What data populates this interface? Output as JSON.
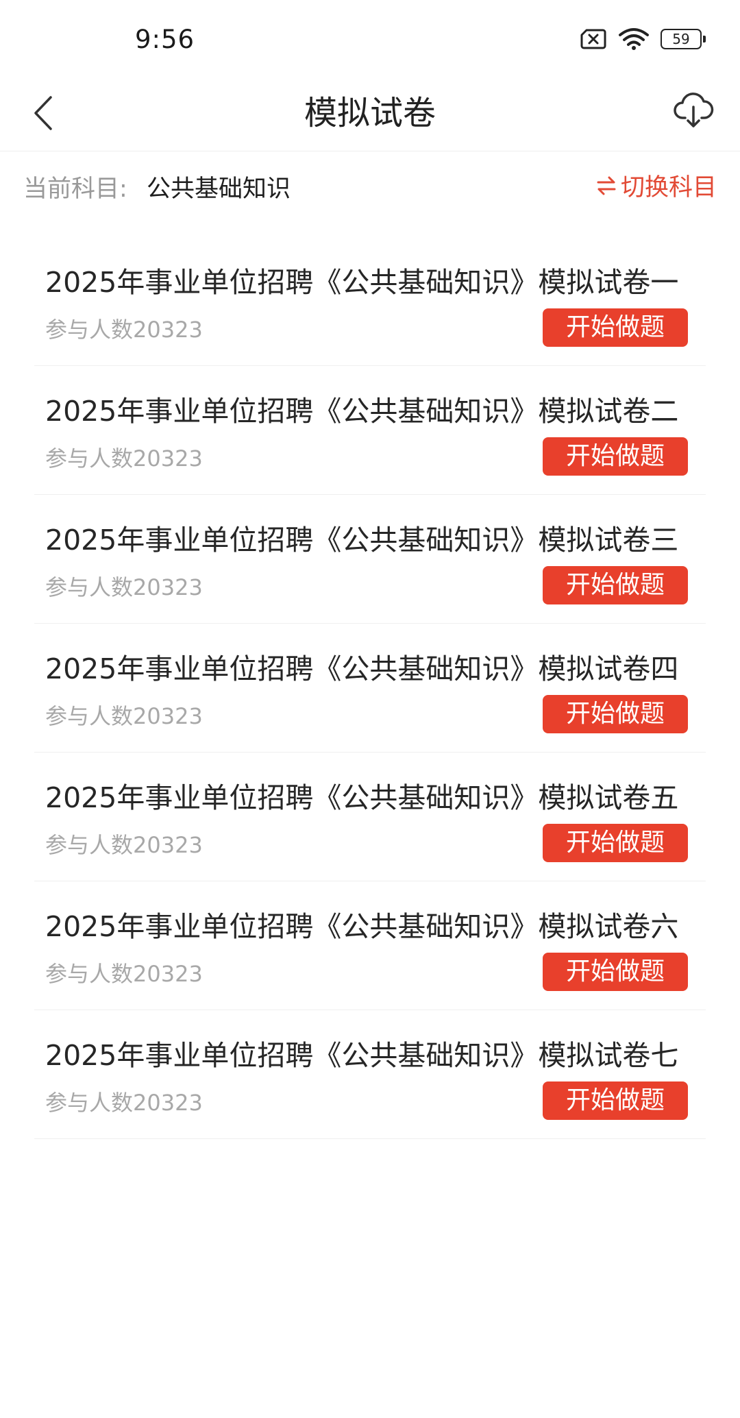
{
  "status_bar": {
    "time": "9:56",
    "battery_level": "59",
    "icons": [
      "sim-no-service-icon",
      "wifi-icon",
      "battery-icon"
    ]
  },
  "header": {
    "title": "模拟试卷",
    "back_icon": "chevron-left-icon",
    "download_icon": "cloud-download-icon"
  },
  "subject": {
    "label": "当前科目:",
    "value": "公共基础知识",
    "switch_label": "切换科目",
    "switch_icon": "swap-arrows-icon"
  },
  "papers": [
    {
      "title": "2025年事业单位招聘《公共基础知识》模拟试卷一",
      "count": "参与人数20323",
      "button": "开始做题"
    },
    {
      "title": "2025年事业单位招聘《公共基础知识》模拟试卷二",
      "count": "参与人数20323",
      "button": "开始做题"
    },
    {
      "title": "2025年事业单位招聘《公共基础知识》模拟试卷三",
      "count": "参与人数20323",
      "button": "开始做题"
    },
    {
      "title": "2025年事业单位招聘《公共基础知识》模拟试卷四",
      "count": "参与人数20323",
      "button": "开始做题"
    },
    {
      "title": "2025年事业单位招聘《公共基础知识》模拟试卷五",
      "count": "参与人数20323",
      "button": "开始做题"
    },
    {
      "title": "2025年事业单位招聘《公共基础知识》模拟试卷六",
      "count": "参与人数20323",
      "button": "开始做题"
    },
    {
      "title": "2025年事业单位招聘《公共基础知识》模拟试卷七",
      "count": "参与人数20323",
      "button": "开始做题"
    }
  ],
  "colors": {
    "accent": "#e8402c",
    "switch_text": "#e24a35",
    "muted_text": "#a8a8a8"
  }
}
